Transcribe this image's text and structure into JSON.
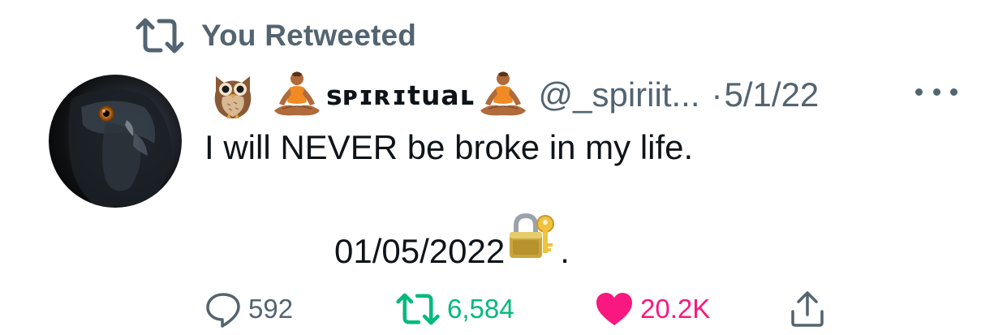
{
  "retweet_context": {
    "text": "You Retweeted",
    "icon": "retweet-icon"
  },
  "tweet": {
    "avatar": "owl-avatar",
    "display_name": "sᴘɪʀɪtuaʟ",
    "name_icons": [
      "owl-emoji",
      "meditating-person-emoji",
      "meditating-person-emoji"
    ],
    "handle": "@_spiriit...",
    "separator": "·",
    "date": "5/1/22",
    "more_icon": "more-icon",
    "text_line1": "I will NEVER be broke in my life.",
    "text_line2_prefix": "01/05/2022",
    "text_line2_suffix": ".",
    "text_icon": "locked-with-key-emoji"
  },
  "actions": {
    "reply_count": "592",
    "retweet_count": "6,584",
    "like_count": "20.2K",
    "retweeted": true,
    "liked": true
  },
  "colors": {
    "text": "#0f1419",
    "secondary": "#536471",
    "retweet_green": "#00ba7c",
    "like_pink": "#f91880"
  }
}
